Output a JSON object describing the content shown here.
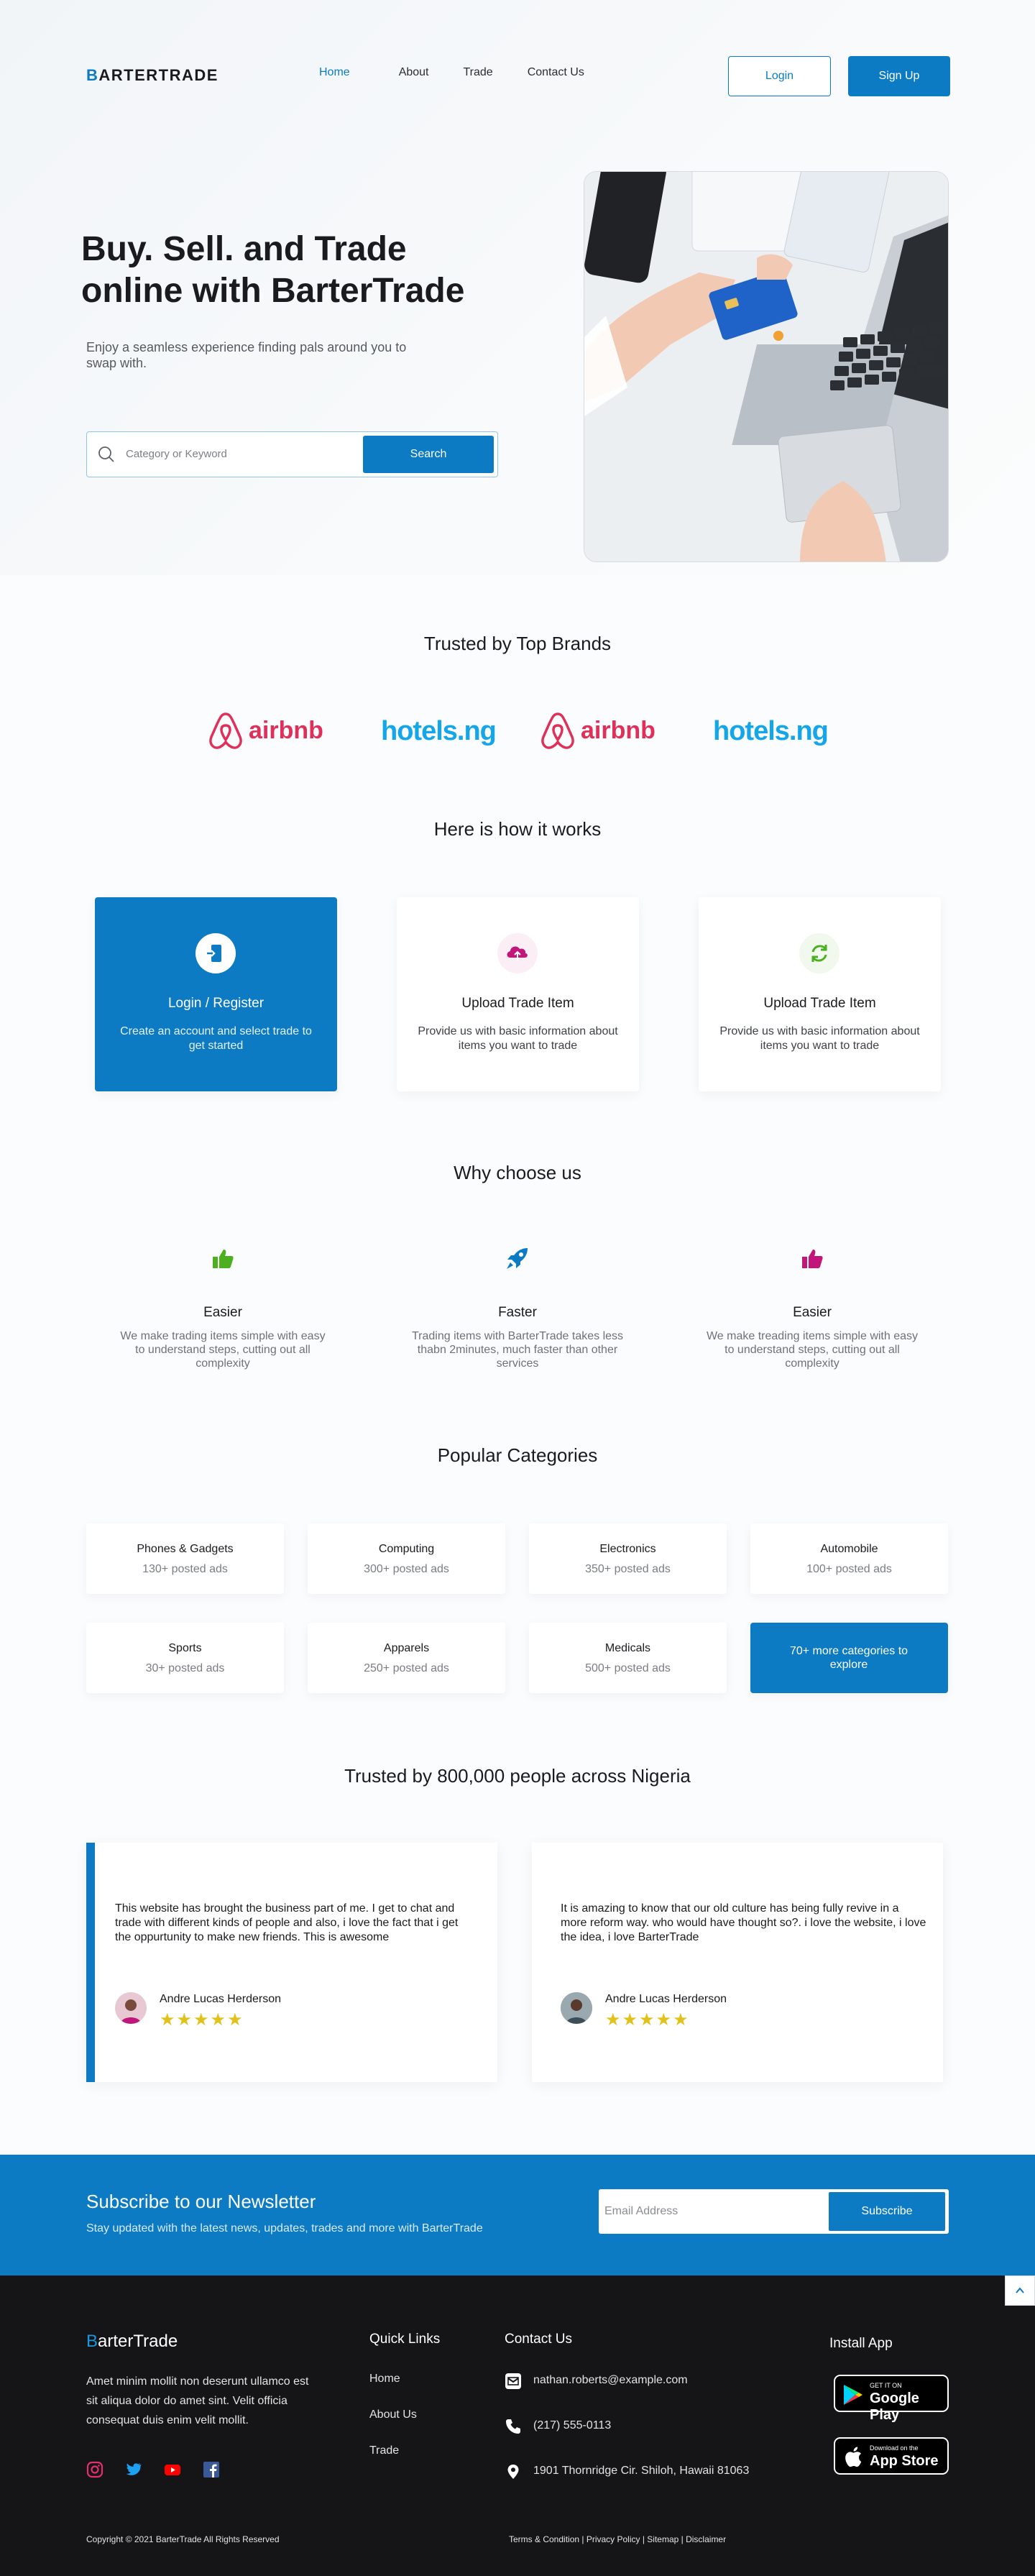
{
  "nav": {
    "logo": "BARTERTRADE",
    "links": [
      "Home",
      "About",
      "Trade",
      "Contact Us"
    ],
    "login": "Login",
    "signup": "Sign Up"
  },
  "hero": {
    "title": "Buy. Sell. and Trade online with BarterTrade",
    "subtitle": "Enjoy a seamless experience finding pals around you to swap with.",
    "search_placeholder": "Category or Keyword",
    "search_button": "Search"
  },
  "brands": {
    "title": "Trusted by Top Brands",
    "items": [
      "airbnb",
      "hotels.ng",
      "airbnb",
      "hotels.ng"
    ]
  },
  "how": {
    "title": "Here is how it works",
    "cards": [
      {
        "title": "Login / Register",
        "desc": "Create an account and select trade to get started",
        "icon": "login-icon"
      },
      {
        "title": "Upload Trade Item",
        "desc": "Provide us with basic information about items you want to trade",
        "icon": "upload-icon"
      },
      {
        "title": "Upload Trade Item",
        "desc": "Provide us with basic information about items you want to trade",
        "icon": "refresh-icon"
      }
    ]
  },
  "why": {
    "title": "Why choose us",
    "items": [
      {
        "title": "Easier",
        "desc": "We make trading items simple with easy to understand steps, cutting out all complexity",
        "icon": "thumbs-up-icon",
        "color": "#4caf1f"
      },
      {
        "title": "Faster",
        "desc": "Trading items with BarterTrade takes less thabn 2minutes, much faster than other services",
        "icon": "rocket-icon",
        "color": "#0c7bc4"
      },
      {
        "title": "Easier",
        "desc": "We make treading items simple with easy to understand steps, cutting out all complexity",
        "icon": "thumbs-up-icon",
        "color": "#c2177a"
      }
    ]
  },
  "categories": {
    "title": "Popular Categories",
    "items": [
      {
        "name": "Phones & Gadgets",
        "count": "130+ posted ads"
      },
      {
        "name": "Computing",
        "count": "300+ posted ads"
      },
      {
        "name": "Electronics",
        "count": "350+ posted ads"
      },
      {
        "name": "Automobile",
        "count": "100+ posted ads"
      },
      {
        "name": "Sports",
        "count": "30+ posted ads"
      },
      {
        "name": "Apparels",
        "count": "250+ posted ads"
      },
      {
        "name": "Medicals",
        "count": "500+ posted ads"
      }
    ],
    "more": "70+ more categories to explore"
  },
  "testimonials": {
    "title": "Trusted by 800,000 people across Nigeria",
    "items": [
      {
        "quote": "This website has brought the business part of me. I get to chat and trade with different kinds of people and also, i love the fact that i get the oppurtunity to make new friends. This is awesome",
        "name": "Andre Lucas Herderson",
        "stars": "★★★★★"
      },
      {
        "quote": "It is amazing to know that our old culture has being fully revive in a more reform way. who would have thought so?. i love the website, i love the idea, i love BarterTrade",
        "name": "Andre Lucas Herderson",
        "stars": "★★★★★"
      }
    ]
  },
  "newsletter": {
    "title": "Subscribe to our Newsletter",
    "subtitle": "Stay updated with the latest news, updates, trades and more with BarterTrade",
    "placeholder": "Email Address",
    "button": "Subscribe"
  },
  "footer": {
    "logo": "BarterTrade",
    "about": "Amet minim mollit non deserunt ullamco est sit aliqua dolor do amet sint. Velit officia consequat duis enim velit mollit.",
    "quick_links_title": "Quick Links",
    "quick_links": [
      "Home",
      "About Us",
      "Trade"
    ],
    "contact_title": "Contact Us",
    "email": "nathan.roberts@example.com",
    "phone": "(217) 555-0113",
    "address": "1901 Thornridge Cir. Shiloh, Hawaii 81063",
    "install_title": "Install App",
    "google_small": "GET IT ON",
    "google_big": "Google Play",
    "apple_small": "Download on the",
    "apple_big": "App Store",
    "copyright": "Copyright © 2021 BarterTrade All Rights Reserved",
    "legal": "Terms & Condition | Privacy Policy | Sitemap | Disclaimer"
  },
  "colors": {
    "brand": "#0c7bc4",
    "footer_bg": "#151517",
    "star": "#e2c21a"
  }
}
